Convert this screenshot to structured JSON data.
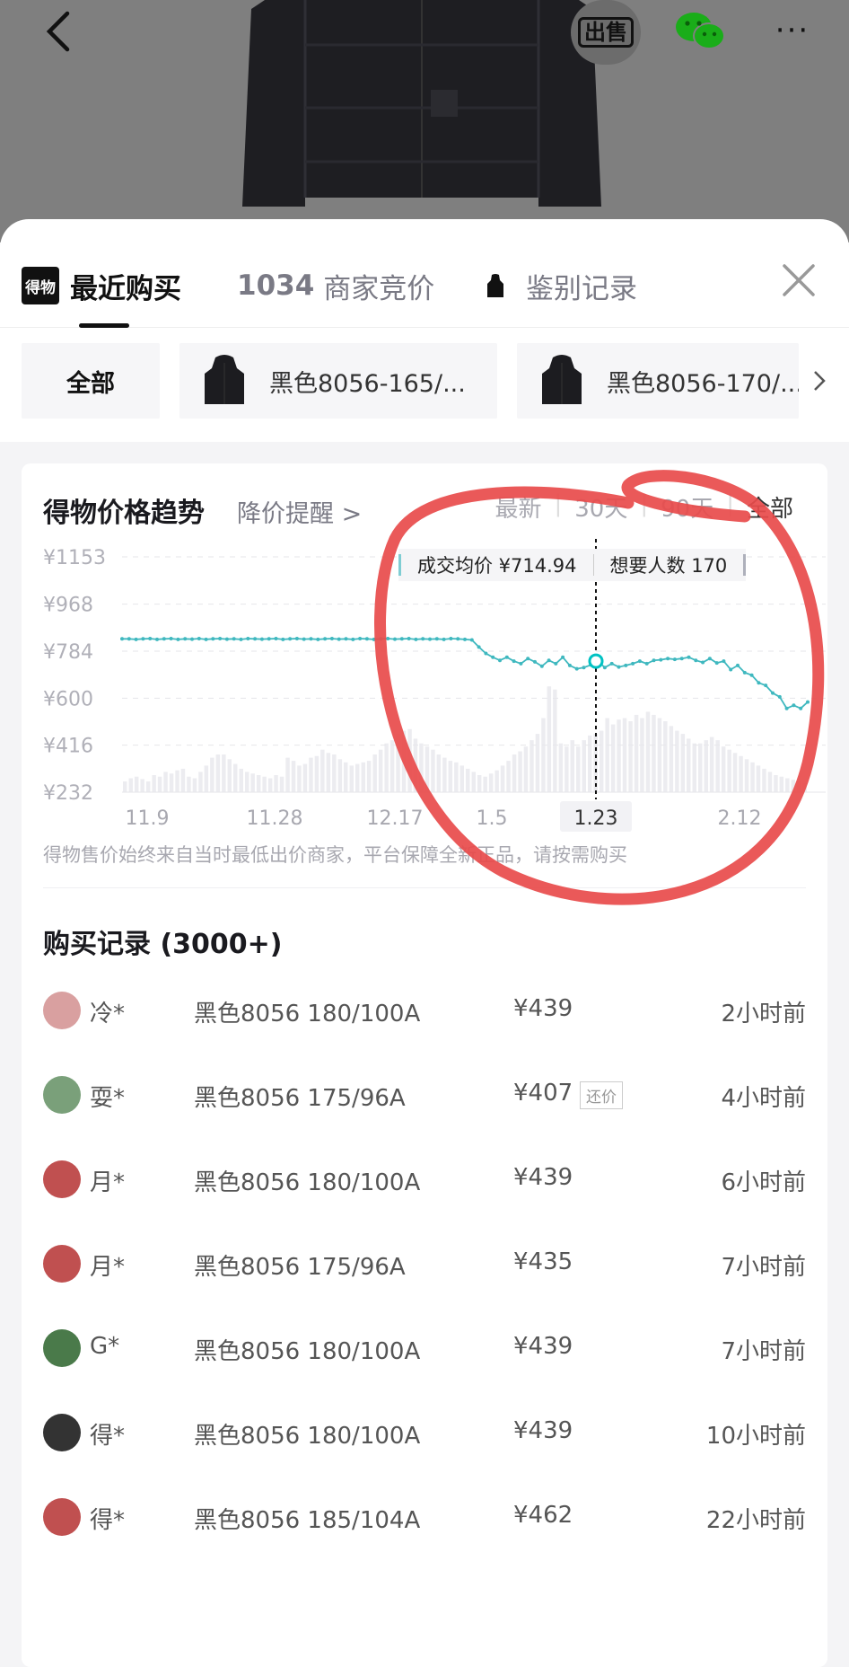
{
  "header": {
    "back_icon": "chevron-left-icon",
    "sell_label": "出售",
    "share_icon": "wechat-icon",
    "more_icon": "more-dots-icon",
    "more_glyph": "···"
  },
  "tabs": [
    {
      "logo": "得物",
      "label": "最近购买",
      "active": true
    },
    {
      "count": "1034",
      "label": "商家竞价",
      "active": false
    },
    {
      "label": "鉴别记录",
      "active": false
    }
  ],
  "close_icon": "close-icon",
  "filters": {
    "all_label": "全部",
    "chips": [
      {
        "label": "黑色8056-165/..."
      },
      {
        "label": "黑色8056-170/..."
      }
    ],
    "arrow_icon": "chevron-right-icon"
  },
  "price_trend": {
    "title": "得物价格趋势",
    "alert_label": "降价提醒 >",
    "ranges": [
      "最新",
      "30天",
      "90天",
      "全部"
    ],
    "active_range": "全部",
    "tooltip": {
      "avg_label": "成交均价 ¥714.94",
      "want_label": "想要人数 170"
    },
    "note": "得物售价始终来自当时最低出价商家，平台保障全新正品，请按需购买"
  },
  "chart_data": {
    "type": "line",
    "y_ticks": [
      "¥1153",
      "¥968",
      "¥784",
      "¥600",
      "¥416",
      "¥232"
    ],
    "y_values": [
      1153,
      968,
      784,
      600,
      416,
      232
    ],
    "ylim": [
      232,
      1153
    ],
    "x_ticks": [
      "11.9",
      "11.28",
      "12.17",
      "1.5",
      "1.23",
      "2.12"
    ],
    "selected_x": "1.23",
    "grid": true,
    "series": [
      {
        "type": "line",
        "values": [
          832,
          832,
          830,
          832,
          833,
          830,
          832,
          833,
          830,
          832,
          831,
          833,
          830,
          832,
          833,
          831,
          832,
          830,
          833,
          832,
          831,
          832,
          833,
          830,
          832,
          833,
          831,
          832,
          830,
          832,
          833,
          831,
          832,
          830,
          833,
          832,
          830,
          832,
          833,
          831,
          832,
          833,
          830,
          832,
          831,
          832,
          830,
          833,
          832,
          830,
          828,
          800,
          775,
          760,
          748,
          760,
          745,
          735,
          755,
          742,
          725,
          748,
          735,
          760,
          728,
          715,
          720,
          730,
          745,
          720,
          735,
          722,
          728,
          735,
          745,
          735,
          748,
          750,
          755,
          752,
          755,
          760,
          748,
          740,
          755,
          738,
          745,
          712,
          728,
          700,
          690,
          660,
          650,
          620,
          605,
          560,
          572,
          560,
          585
        ]
      },
      {
        "type": "bar",
        "values": [
          300,
          320,
          330,
          315,
          300,
          340,
          330,
          360,
          350,
          370,
          380,
          330,
          320,
          360,
          400,
          450,
          470,
          470,
          440,
          410,
          380,
          360,
          350,
          340,
          330,
          320,
          340,
          330,
          450,
          430,
          400,
          410,
          450,
          460,
          500,
          480,
          470,
          440,
          420,
          400,
          410,
          420,
          430,
          470,
          500,
          540,
          560,
          600,
          620,
          630,
          570,
          540,
          520,
          500,
          470,
          450,
          430,
          420,
          400,
          380,
          360,
          340,
          330,
          350,
          370,
          400,
          430,
          470,
          490,
          520,
          560,
          600,
          700,
          900,
          880,
          540,
          520,
          560,
          520,
          560,
          590,
          600,
          620,
          700,
          660,
          690,
          700,
          680,
          720,
          700,
          740,
          720,
          700,
          680,
          650,
          620,
          600,
          570,
          540,
          540,
          560,
          580,
          560,
          520,
          500,
          480,
          460,
          440,
          420,
          400,
          380,
          360,
          340,
          330,
          320,
          310,
          300,
          290
        ]
      }
    ]
  },
  "records": {
    "title": "购买记录 (3000+)",
    "rows": [
      {
        "user": "冷*",
        "sku": "黑色8056 180/100A",
        "price": "¥439",
        "badge": "",
        "time": "2小时前",
        "avatar_color": "#d9a0a0"
      },
      {
        "user": "耍*",
        "sku": "黑色8056 175/96A",
        "price": "¥407",
        "badge": "还价",
        "time": "4小时前",
        "avatar_color": "#7aa07a"
      },
      {
        "user": "月*",
        "sku": "黑色8056 180/100A",
        "price": "¥439",
        "badge": "",
        "time": "6小时前",
        "avatar_color": "#c05050"
      },
      {
        "user": "月*",
        "sku": "黑色8056 175/96A",
        "price": "¥435",
        "badge": "",
        "time": "7小时前",
        "avatar_color": "#c05050"
      },
      {
        "user": "G*",
        "sku": "黑色8056 180/100A",
        "price": "¥439",
        "badge": "",
        "time": "7小时前",
        "avatar_color": "#4a7a4a"
      },
      {
        "user": "得*",
        "sku": "黑色8056 180/100A",
        "price": "¥439",
        "badge": "",
        "time": "10小时前",
        "avatar_color": "#333333"
      },
      {
        "user": "得*",
        "sku": "黑色8056 185/104A",
        "price": "¥462",
        "badge": "",
        "time": "22小时前",
        "avatar_color": "#c05050"
      }
    ]
  },
  "colors": {
    "accent": "#01c2c3",
    "line": "#3fb8bf",
    "annotation": "#e84b4b",
    "bar": "#ececf0"
  }
}
